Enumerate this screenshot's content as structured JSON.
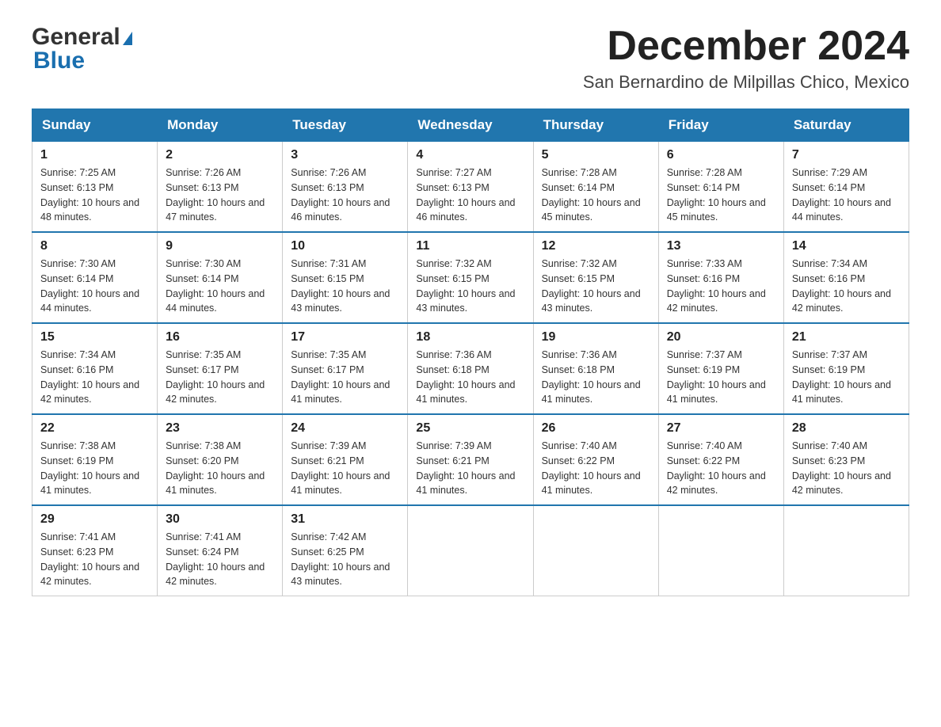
{
  "logo": {
    "text_general": "General",
    "text_blue": "Blue"
  },
  "header": {
    "title": "December 2024",
    "subtitle": "San Bernardino de Milpillas Chico, Mexico"
  },
  "days_of_week": [
    "Sunday",
    "Monday",
    "Tuesday",
    "Wednesday",
    "Thursday",
    "Friday",
    "Saturday"
  ],
  "weeks": [
    [
      {
        "day": "1",
        "sunrise": "7:25 AM",
        "sunset": "6:13 PM",
        "daylight": "10 hours and 48 minutes."
      },
      {
        "day": "2",
        "sunrise": "7:26 AM",
        "sunset": "6:13 PM",
        "daylight": "10 hours and 47 minutes."
      },
      {
        "day": "3",
        "sunrise": "7:26 AM",
        "sunset": "6:13 PM",
        "daylight": "10 hours and 46 minutes."
      },
      {
        "day": "4",
        "sunrise": "7:27 AM",
        "sunset": "6:13 PM",
        "daylight": "10 hours and 46 minutes."
      },
      {
        "day": "5",
        "sunrise": "7:28 AM",
        "sunset": "6:14 PM",
        "daylight": "10 hours and 45 minutes."
      },
      {
        "day": "6",
        "sunrise": "7:28 AM",
        "sunset": "6:14 PM",
        "daylight": "10 hours and 45 minutes."
      },
      {
        "day": "7",
        "sunrise": "7:29 AM",
        "sunset": "6:14 PM",
        "daylight": "10 hours and 44 minutes."
      }
    ],
    [
      {
        "day": "8",
        "sunrise": "7:30 AM",
        "sunset": "6:14 PM",
        "daylight": "10 hours and 44 minutes."
      },
      {
        "day": "9",
        "sunrise": "7:30 AM",
        "sunset": "6:14 PM",
        "daylight": "10 hours and 44 minutes."
      },
      {
        "day": "10",
        "sunrise": "7:31 AM",
        "sunset": "6:15 PM",
        "daylight": "10 hours and 43 minutes."
      },
      {
        "day": "11",
        "sunrise": "7:32 AM",
        "sunset": "6:15 PM",
        "daylight": "10 hours and 43 minutes."
      },
      {
        "day": "12",
        "sunrise": "7:32 AM",
        "sunset": "6:15 PM",
        "daylight": "10 hours and 43 minutes."
      },
      {
        "day": "13",
        "sunrise": "7:33 AM",
        "sunset": "6:16 PM",
        "daylight": "10 hours and 42 minutes."
      },
      {
        "day": "14",
        "sunrise": "7:34 AM",
        "sunset": "6:16 PM",
        "daylight": "10 hours and 42 minutes."
      }
    ],
    [
      {
        "day": "15",
        "sunrise": "7:34 AM",
        "sunset": "6:16 PM",
        "daylight": "10 hours and 42 minutes."
      },
      {
        "day": "16",
        "sunrise": "7:35 AM",
        "sunset": "6:17 PM",
        "daylight": "10 hours and 42 minutes."
      },
      {
        "day": "17",
        "sunrise": "7:35 AM",
        "sunset": "6:17 PM",
        "daylight": "10 hours and 41 minutes."
      },
      {
        "day": "18",
        "sunrise": "7:36 AM",
        "sunset": "6:18 PM",
        "daylight": "10 hours and 41 minutes."
      },
      {
        "day": "19",
        "sunrise": "7:36 AM",
        "sunset": "6:18 PM",
        "daylight": "10 hours and 41 minutes."
      },
      {
        "day": "20",
        "sunrise": "7:37 AM",
        "sunset": "6:19 PM",
        "daylight": "10 hours and 41 minutes."
      },
      {
        "day": "21",
        "sunrise": "7:37 AM",
        "sunset": "6:19 PM",
        "daylight": "10 hours and 41 minutes."
      }
    ],
    [
      {
        "day": "22",
        "sunrise": "7:38 AM",
        "sunset": "6:19 PM",
        "daylight": "10 hours and 41 minutes."
      },
      {
        "day": "23",
        "sunrise": "7:38 AM",
        "sunset": "6:20 PM",
        "daylight": "10 hours and 41 minutes."
      },
      {
        "day": "24",
        "sunrise": "7:39 AM",
        "sunset": "6:21 PM",
        "daylight": "10 hours and 41 minutes."
      },
      {
        "day": "25",
        "sunrise": "7:39 AM",
        "sunset": "6:21 PM",
        "daylight": "10 hours and 41 minutes."
      },
      {
        "day": "26",
        "sunrise": "7:40 AM",
        "sunset": "6:22 PM",
        "daylight": "10 hours and 41 minutes."
      },
      {
        "day": "27",
        "sunrise": "7:40 AM",
        "sunset": "6:22 PM",
        "daylight": "10 hours and 42 minutes."
      },
      {
        "day": "28",
        "sunrise": "7:40 AM",
        "sunset": "6:23 PM",
        "daylight": "10 hours and 42 minutes."
      }
    ],
    [
      {
        "day": "29",
        "sunrise": "7:41 AM",
        "sunset": "6:23 PM",
        "daylight": "10 hours and 42 minutes."
      },
      {
        "day": "30",
        "sunrise": "7:41 AM",
        "sunset": "6:24 PM",
        "daylight": "10 hours and 42 minutes."
      },
      {
        "day": "31",
        "sunrise": "7:42 AM",
        "sunset": "6:25 PM",
        "daylight": "10 hours and 43 minutes."
      },
      null,
      null,
      null,
      null
    ]
  ]
}
